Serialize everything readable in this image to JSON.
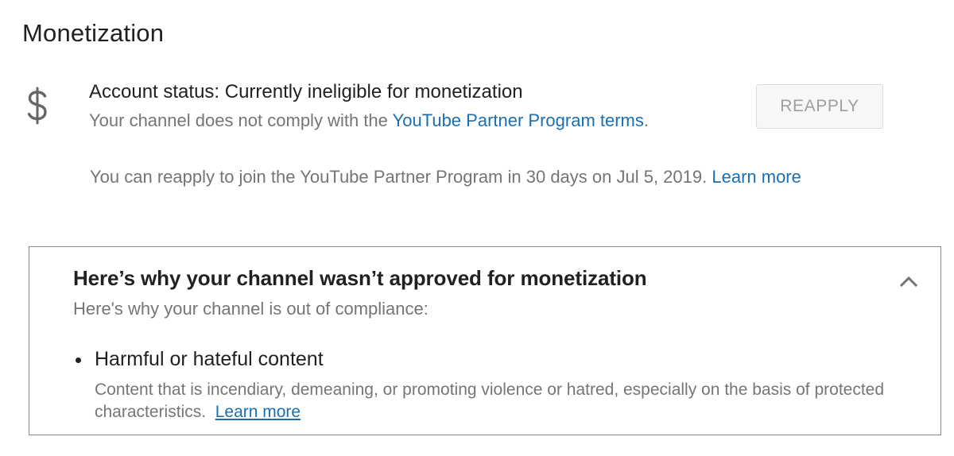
{
  "section": {
    "title": "Monetization"
  },
  "account": {
    "icon": "dollar-icon",
    "status_line": "Account status: Currently ineligible for monetization",
    "subtitle_prefix": "Your channel does not comply with the ",
    "subtitle_link": "YouTube Partner Program terms",
    "subtitle_suffix": ".",
    "reapply_button": "REAPPLY",
    "reapply_note": "You can reapply to join the YouTube Partner Program in 30 days on Jul 5, 2019.",
    "reapply_note_link": "Learn more"
  },
  "reasons": {
    "title": "Here’s why your channel wasn’t approved for monetization",
    "subtitle": "Here's why your channel is out of compliance:",
    "collapse_icon": "chevron-up-icon",
    "items": [
      {
        "title": "Harmful or hateful content",
        "description": "Content that is incendiary, demeaning, or promoting violence or hatred, especially on the basis of protected characteristics.",
        "link": "Learn more"
      }
    ]
  },
  "colors": {
    "link": "#1a6fb3",
    "text_primary": "#212121",
    "text_secondary": "#757575",
    "button_text_disabled": "#9e9e9e"
  }
}
